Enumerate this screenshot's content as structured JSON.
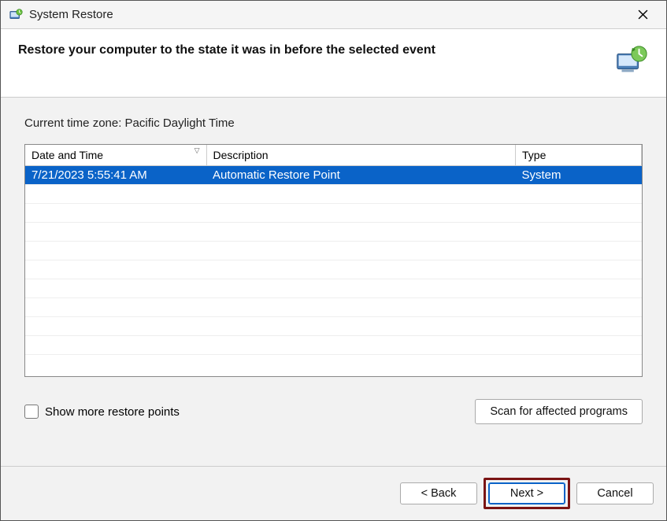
{
  "window": {
    "title": "System Restore"
  },
  "header": {
    "heading": "Restore your computer to the state it was in before the selected event"
  },
  "body": {
    "timezone_label": "Current time zone: Pacific Daylight Time",
    "columns": {
      "datetime": "Date and Time",
      "description": "Description",
      "type": "Type"
    },
    "rows": [
      {
        "datetime": "7/21/2023 5:55:41 AM",
        "description": "Automatic Restore Point",
        "type": "System",
        "selected": true
      }
    ],
    "show_more_label": "Show more restore points",
    "scan_button": "Scan for affected programs"
  },
  "footer": {
    "back": "< Back",
    "next": "Next >",
    "cancel": "Cancel"
  }
}
